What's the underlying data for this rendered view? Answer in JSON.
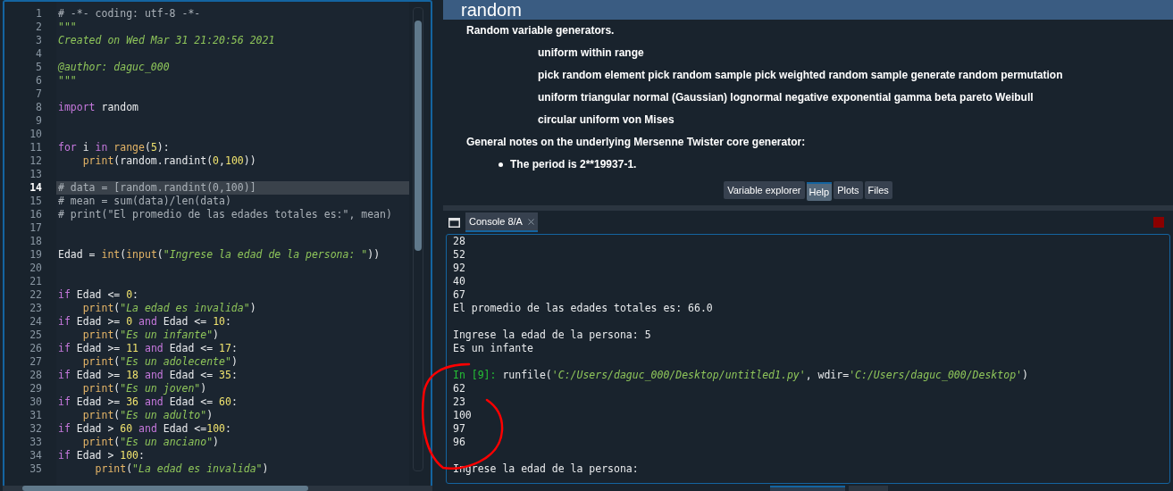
{
  "editor": {
    "lines": [
      {
        "number": "1",
        "current": false,
        "tokens": [
          {
            "kind": "comment",
            "text": "# -*- coding: utf-8 -*-"
          }
        ]
      },
      {
        "number": "2",
        "current": false,
        "tokens": [
          {
            "kind": "docstring",
            "text": "\"\"\""
          }
        ]
      },
      {
        "number": "3",
        "current": false,
        "tokens": [
          {
            "kind": "docstring",
            "text": "Created on Wed Mar 31 21:20:56 2021"
          }
        ]
      },
      {
        "number": "4",
        "current": false
      },
      {
        "number": "5",
        "current": false,
        "tokens": [
          {
            "kind": "docstring",
            "text": "@author: daguc_000"
          }
        ]
      },
      {
        "number": "6",
        "current": false,
        "tokens": [
          {
            "kind": "docstring",
            "text": "\"\"\""
          }
        ]
      },
      {
        "number": "7",
        "current": false
      },
      {
        "number": "8",
        "current": false,
        "tokens": [
          {
            "kind": "keyword",
            "text": "import"
          },
          {
            "kind": "plain",
            "text": " random"
          }
        ]
      },
      {
        "number": "9",
        "current": false
      },
      {
        "number": "10",
        "current": false
      },
      {
        "number": "11",
        "current": false,
        "tokens": [
          {
            "kind": "keyword",
            "text": "for"
          },
          {
            "kind": "plain",
            "text": " i "
          },
          {
            "kind": "keyword",
            "text": "in"
          },
          {
            "kind": "builtin",
            "text": " range"
          },
          {
            "kind": "plain",
            "text": "("
          },
          {
            "kind": "number",
            "text": "5"
          },
          {
            "kind": "plain",
            "text": "):"
          }
        ]
      },
      {
        "number": "12",
        "current": false,
        "tokens": [
          {
            "kind": "builtin",
            "text": "    print"
          },
          {
            "kind": "plain",
            "text": "(random.randint("
          },
          {
            "kind": "number",
            "text": "0"
          },
          {
            "kind": "plain",
            "text": ","
          },
          {
            "kind": "number",
            "text": "100"
          },
          {
            "kind": "plain",
            "text": "))"
          }
        ]
      },
      {
        "number": "13",
        "current": false
      },
      {
        "number": "14",
        "current": true,
        "tokens": [
          {
            "kind": "comment",
            "text": "# data = [random.randint(0,100)]"
          }
        ]
      },
      {
        "number": "15",
        "current": false,
        "tokens": [
          {
            "kind": "comment",
            "text": "# mean = sum(data)/len(data)"
          }
        ]
      },
      {
        "number": "16",
        "current": false,
        "tokens": [
          {
            "kind": "comment",
            "text": "# print(\"El promedio de las edades totales es:\", mean)"
          }
        ]
      },
      {
        "number": "17",
        "current": false
      },
      {
        "number": "18",
        "current": false
      },
      {
        "number": "19",
        "current": false,
        "tokens": [
          {
            "kind": "plain",
            "text": "Edad = "
          },
          {
            "kind": "builtin",
            "text": "int"
          },
          {
            "kind": "plain",
            "text": "("
          },
          {
            "kind": "builtin",
            "text": "input"
          },
          {
            "kind": "plain",
            "text": "("
          },
          {
            "kind": "string",
            "text": "\"Ingrese la edad de la persona: \""
          },
          {
            "kind": "plain",
            "text": "))"
          }
        ]
      },
      {
        "number": "20",
        "current": false
      },
      {
        "number": "21",
        "current": false
      },
      {
        "number": "22",
        "current": false,
        "tokens": [
          {
            "kind": "keyword",
            "text": "if"
          },
          {
            "kind": "plain",
            "text": " Edad <= "
          },
          {
            "kind": "number",
            "text": "0"
          },
          {
            "kind": "plain",
            "text": ":"
          }
        ]
      },
      {
        "number": "23",
        "current": false,
        "tokens": [
          {
            "kind": "builtin",
            "text": "    print"
          },
          {
            "kind": "plain",
            "text": "("
          },
          {
            "kind": "string",
            "text": "\"La edad es invalida\""
          },
          {
            "kind": "plain",
            "text": ")"
          }
        ]
      },
      {
        "number": "24",
        "current": false,
        "tokens": [
          {
            "kind": "keyword",
            "text": "if"
          },
          {
            "kind": "plain",
            "text": " Edad >= "
          },
          {
            "kind": "number",
            "text": "0"
          },
          {
            "kind": "keyword",
            "text": " and"
          },
          {
            "kind": "plain",
            "text": " Edad <= "
          },
          {
            "kind": "number",
            "text": "10"
          },
          {
            "kind": "plain",
            "text": ":"
          }
        ]
      },
      {
        "number": "25",
        "current": false,
        "tokens": [
          {
            "kind": "builtin",
            "text": "    print"
          },
          {
            "kind": "plain",
            "text": "("
          },
          {
            "kind": "string",
            "text": "\"Es un infante\""
          },
          {
            "kind": "plain",
            "text": ")"
          }
        ]
      },
      {
        "number": "26",
        "current": false,
        "tokens": [
          {
            "kind": "keyword",
            "text": "if"
          },
          {
            "kind": "plain",
            "text": " Edad >= "
          },
          {
            "kind": "number",
            "text": "11"
          },
          {
            "kind": "keyword",
            "text": " and"
          },
          {
            "kind": "plain",
            "text": " Edad <= "
          },
          {
            "kind": "number",
            "text": "17"
          },
          {
            "kind": "plain",
            "text": ":"
          }
        ]
      },
      {
        "number": "27",
        "current": false,
        "tokens": [
          {
            "kind": "builtin",
            "text": "    print"
          },
          {
            "kind": "plain",
            "text": "("
          },
          {
            "kind": "string",
            "text": "\"Es un adolecente\""
          },
          {
            "kind": "plain",
            "text": ")"
          }
        ]
      },
      {
        "number": "28",
        "current": false,
        "tokens": [
          {
            "kind": "keyword",
            "text": "if"
          },
          {
            "kind": "plain",
            "text": " Edad >= "
          },
          {
            "kind": "number",
            "text": "18"
          },
          {
            "kind": "keyword",
            "text": " and"
          },
          {
            "kind": "plain",
            "text": " Edad <= "
          },
          {
            "kind": "number",
            "text": "35"
          },
          {
            "kind": "plain",
            "text": ":"
          }
        ]
      },
      {
        "number": "29",
        "current": false,
        "tokens": [
          {
            "kind": "builtin",
            "text": "    print"
          },
          {
            "kind": "plain",
            "text": "("
          },
          {
            "kind": "string",
            "text": "\"Es un joven\""
          },
          {
            "kind": "plain",
            "text": ")"
          }
        ]
      },
      {
        "number": "30",
        "current": false,
        "tokens": [
          {
            "kind": "keyword",
            "text": "if"
          },
          {
            "kind": "plain",
            "text": " Edad >= "
          },
          {
            "kind": "number",
            "text": "36"
          },
          {
            "kind": "keyword",
            "text": " and"
          },
          {
            "kind": "plain",
            "text": " Edad <= "
          },
          {
            "kind": "number",
            "text": "60"
          },
          {
            "kind": "plain",
            "text": ":"
          }
        ]
      },
      {
        "number": "31",
        "current": false,
        "tokens": [
          {
            "kind": "builtin",
            "text": "    print"
          },
          {
            "kind": "plain",
            "text": "("
          },
          {
            "kind": "string",
            "text": "\"Es un adulto\""
          },
          {
            "kind": "plain",
            "text": ")"
          }
        ]
      },
      {
        "number": "32",
        "current": false,
        "tokens": [
          {
            "kind": "keyword",
            "text": "if"
          },
          {
            "kind": "plain",
            "text": " Edad > "
          },
          {
            "kind": "number",
            "text": "60"
          },
          {
            "kind": "keyword",
            "text": " and"
          },
          {
            "kind": "plain",
            "text": " Edad <="
          },
          {
            "kind": "number",
            "text": "100"
          },
          {
            "kind": "plain",
            "text": ":"
          }
        ]
      },
      {
        "number": "33",
        "current": false,
        "tokens": [
          {
            "kind": "builtin",
            "text": "    print"
          },
          {
            "kind": "plain",
            "text": "("
          },
          {
            "kind": "string",
            "text": "\"Es un anciano\""
          },
          {
            "kind": "plain",
            "text": ")"
          }
        ]
      },
      {
        "number": "34",
        "current": false,
        "tokens": [
          {
            "kind": "keyword",
            "text": "if"
          },
          {
            "kind": "plain",
            "text": " Edad > "
          },
          {
            "kind": "number",
            "text": "100"
          },
          {
            "kind": "plain",
            "text": ":"
          }
        ]
      },
      {
        "number": "35",
        "current": false,
        "tokens": [
          {
            "kind": "builtin",
            "text": "      print"
          },
          {
            "kind": "plain",
            "text": "("
          },
          {
            "kind": "string",
            "text": "\"La edad es invalida\""
          },
          {
            "kind": "plain",
            "text": ")"
          }
        ]
      }
    ]
  },
  "help": {
    "title": "random",
    "paragraphs": [
      {
        "kind": "para",
        "text": "Random variable generators."
      },
      {
        "kind": "indented",
        "text": "uniform within range"
      },
      {
        "kind": "indented",
        "text": "pick random element pick random sample pick weighted random sample generate random permutation"
      },
      {
        "kind": "indented",
        "text": "uniform triangular normal (Gaussian) lognormal negative exponential gamma beta pareto Weibull"
      },
      {
        "kind": "indented",
        "text": "circular uniform von Mises"
      },
      {
        "kind": "para",
        "text": "General notes on the underlying Mersenne Twister core generator:"
      },
      {
        "kind": "bullet",
        "text": "The period is 2**19937-1."
      }
    ]
  },
  "pane_tabs": [
    {
      "label": "Variable explorer",
      "selected": false
    },
    {
      "label": "Help",
      "selected": true
    },
    {
      "label": "Plots",
      "selected": false
    },
    {
      "label": "Files",
      "selected": false
    }
  ],
  "console": {
    "tab": {
      "label": "Console 8/A",
      "selected": true
    },
    "lines": [
      {
        "kind": "text",
        "tokens": [
          {
            "kind": "plain",
            "text": "28"
          }
        ]
      },
      {
        "kind": "text",
        "tokens": [
          {
            "kind": "plain",
            "text": "52"
          }
        ]
      },
      {
        "kind": "text",
        "tokens": [
          {
            "kind": "plain",
            "text": "92"
          }
        ]
      },
      {
        "kind": "text",
        "tokens": [
          {
            "kind": "plain",
            "text": "40"
          }
        ]
      },
      {
        "kind": "text",
        "tokens": [
          {
            "kind": "plain",
            "text": "67"
          }
        ]
      },
      {
        "kind": "text",
        "tokens": [
          {
            "kind": "plain",
            "text": "El promedio de las edades totales es: 66.0"
          }
        ]
      },
      {
        "kind": "blank"
      },
      {
        "kind": "text",
        "tokens": [
          {
            "kind": "plain",
            "text": "Ingrese la edad de la persona: 5"
          }
        ]
      },
      {
        "kind": "text",
        "tokens": [
          {
            "kind": "plain",
            "text": "Es un infante"
          }
        ]
      },
      {
        "kind": "blank"
      },
      {
        "kind": "text",
        "tokens": [
          {
            "kind": "prompt",
            "text": "In [9]:"
          },
          {
            "kind": "plain",
            "text": " runfile("
          },
          {
            "kind": "string",
            "text": "'C:/Users/daguc_000/Desktop/untitled1.py'"
          },
          {
            "kind": "plain",
            "text": ", wdir="
          },
          {
            "kind": "string",
            "text": "'C:/Users/daguc_000/Desktop'"
          },
          {
            "kind": "plain",
            "text": ")"
          }
        ]
      },
      {
        "kind": "text",
        "tokens": [
          {
            "kind": "plain",
            "text": "62"
          }
        ]
      },
      {
        "kind": "text",
        "tokens": [
          {
            "kind": "plain",
            "text": "23"
          }
        ]
      },
      {
        "kind": "text",
        "tokens": [
          {
            "kind": "plain",
            "text": "100"
          }
        ]
      },
      {
        "kind": "text",
        "tokens": [
          {
            "kind": "plain",
            "text": "97"
          }
        ]
      },
      {
        "kind": "text",
        "tokens": [
          {
            "kind": "plain",
            "text": "96"
          }
        ]
      },
      {
        "kind": "blank"
      },
      {
        "kind": "text",
        "tokens": [
          {
            "kind": "plain",
            "text": "Ingrese la edad de la persona:"
          }
        ]
      }
    ]
  }
}
